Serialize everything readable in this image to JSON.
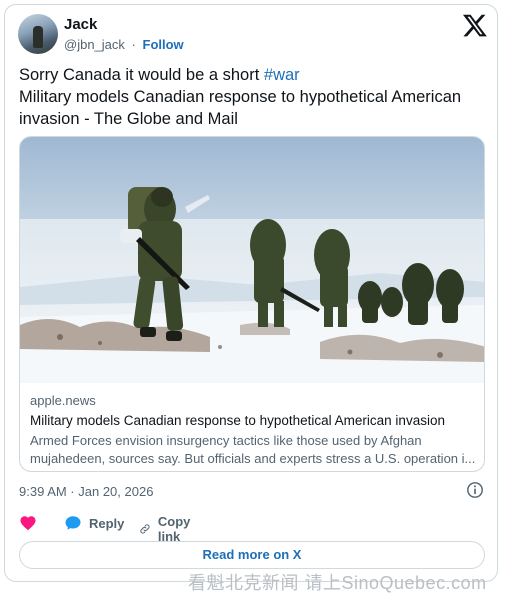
{
  "author": {
    "name": "Jack",
    "handle": "@jbn_jack",
    "separator": "·",
    "follow_label": "Follow"
  },
  "tweet": {
    "line1_text": "Sorry Canada it would be a short ",
    "hashtag": "#war",
    "line2_text": "Military models Canadian response to hypothetical American invasion - The Globe and Mail"
  },
  "link_card": {
    "domain": "apple.news",
    "title": "Military models Canadian response to hypothetical American invasion",
    "description": "Armed Forces envision insurgency tactics like those used by Afghan mujahedeen, sources say. But officials and experts stress a U.S. operation i..."
  },
  "timestamp": "9:39 AM · Jan 20, 2026",
  "actions": {
    "like_icon": "heart-icon",
    "reply_label": "Reply",
    "copy_label": "Copy link"
  },
  "read_more": "Read more on X",
  "watermark": "看魁北克新闻 请上SinoQuebec.com",
  "colors": {
    "link": "#1d6fb8",
    "like": "#f91880",
    "secondary": "#536471",
    "border": "#cfd9de"
  }
}
